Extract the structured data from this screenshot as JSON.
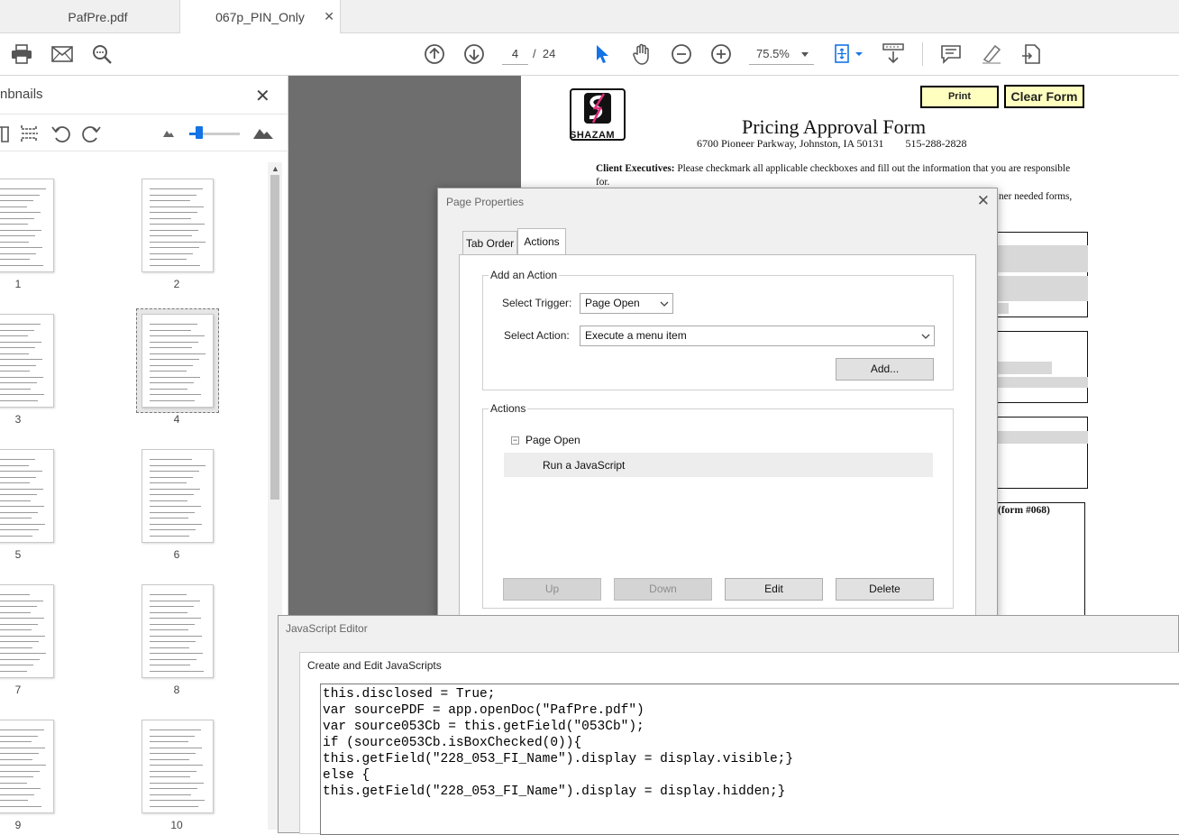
{
  "tabs": [
    {
      "label": "PafPre.pdf",
      "active": false
    },
    {
      "label": "067p_PIN_Only",
      "active": true,
      "close": "✕"
    }
  ],
  "toolbar": {
    "current_page": "4",
    "page_separator": "/",
    "total_pages": "24",
    "zoom": "75.5%"
  },
  "sidebar": {
    "title": "nbnails",
    "close": "✕",
    "zoom_slider_fraction": 0.2,
    "thumbnails": [
      {
        "label": "1"
      },
      {
        "label": "2"
      },
      {
        "label": "3"
      },
      {
        "label": "4",
        "selected": true
      },
      {
        "label": "5"
      },
      {
        "label": "6"
      },
      {
        "label": "7"
      },
      {
        "label": "8"
      },
      {
        "label": "9"
      },
      {
        "label": "10"
      }
    ]
  },
  "document": {
    "print_button": "Print",
    "clear_button": "Clear Form",
    "logo_text": "SHAZAM",
    "form_title": "Pricing Approval Form",
    "address": "6700 Pioneer Parkway, Johnston, IA 50131        515-288-2828",
    "instruction_bold": "Client Executives:",
    "instruction_line1": " Please checkmark all applicable checkboxes and fill out the information that you are responsible",
    "instruction_line2": "for.",
    "partial_text": "ner needed forms,",
    "form_ref": "(form #068)"
  },
  "page_properties": {
    "title": "Page Properties",
    "close": "✕",
    "tabs": [
      "Tab Order",
      "Actions"
    ],
    "active_tab": "Actions",
    "add_action_group": "Add an Action",
    "select_trigger_label": "Select Trigger:",
    "select_trigger_value": "Page Open",
    "select_action_label": "Select Action:",
    "select_action_value": "Execute a menu item",
    "add_button": "Add...",
    "actions_group": "Actions",
    "tree": {
      "trigger": "Page Open",
      "expander": "−",
      "action": "Run a JavaScript"
    },
    "buttons": {
      "up": "Up",
      "down": "Down",
      "edit": "Edit",
      "delete": "Delete"
    }
  },
  "js_editor": {
    "title": "JavaScript Editor",
    "label": "Create and Edit JavaScripts",
    "code_lines": [
      "this.disclosed = True;",
      "var sourcePDF = app.openDoc(\"PafPre.pdf\")",
      "var source053Cb = this.getField(\"053Cb\");",
      "if (source053Cb.isBoxChecked(0)){",
      "this.getField(\"228_053_FI_Name\").display = display.visible;}",
      "else {",
      "this.getField(\"228_053_FI_Name\").display = display.hidden;}"
    ]
  },
  "colors": {
    "accent": "#1473e6",
    "doc_background": "#6e6e6e",
    "form_button_fill": "#ffffc0",
    "logo_bolt": "#e0307a"
  }
}
